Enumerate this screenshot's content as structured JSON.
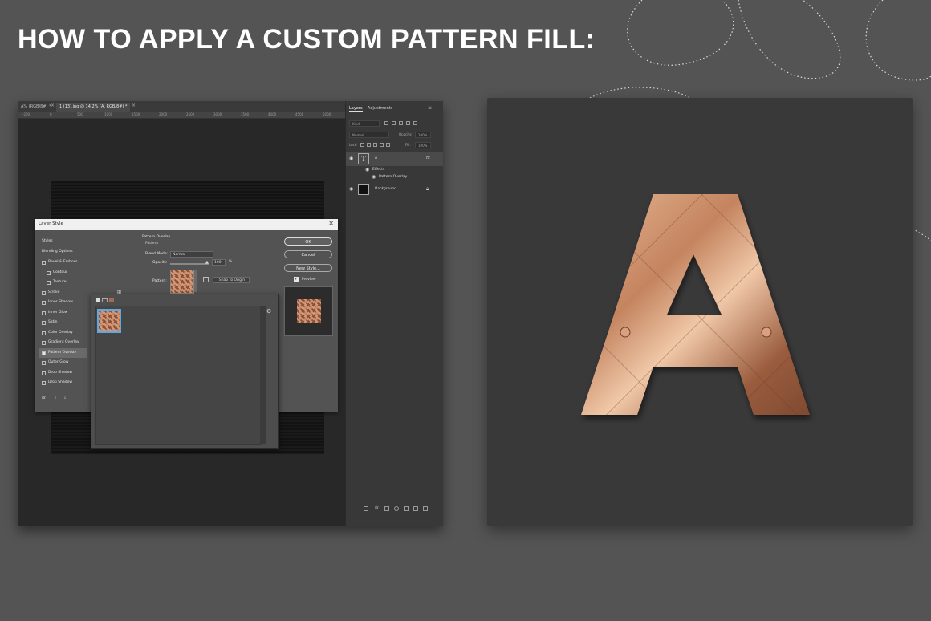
{
  "headline": "HOW TO APPLY A CUSTOM PATTERN FILL:",
  "colors": {
    "page_bg": "#545454",
    "result_bg": "#393939",
    "copper_light": "#e8b896",
    "copper_mid": "#c4845f",
    "copper_dark": "#7e4a31"
  },
  "photoshop": {
    "tabs": [
      {
        "label": "A% (RGB/8#) *",
        "active": false
      },
      {
        "label": "1 (13).jpg @ 14,2% (A, RGB/8#) *",
        "active": true
      }
    ],
    "ruler_ticks": [
      "-200",
      "0",
      "500",
      "1000",
      "1500",
      "2000",
      "2500",
      "3000",
      "3500",
      "4000",
      "4500",
      "5000"
    ],
    "layers_panel": {
      "tabs": [
        "Layers",
        "Adjustments"
      ],
      "kind_filter": "Kind",
      "blend_mode": "Normal",
      "opacity_label": "Opacity:",
      "opacity_value": "100%",
      "lock_label": "Lock:",
      "fill_label": "Fill:",
      "fill_value": "100%",
      "layers": [
        {
          "name": "A",
          "thumb": "T",
          "selected": true,
          "fx": "fx"
        },
        {
          "name": "Effects",
          "sub": true
        },
        {
          "name": "Pattern Overlay",
          "sub2": true
        },
        {
          "name": "Background",
          "thumb": "",
          "locked": true
        }
      ]
    },
    "layer_style": {
      "title": "Layer Style",
      "close": "✕",
      "styles_header": "Styles",
      "blending_options": "Blending Options",
      "items": [
        {
          "label": "Bevel & Emboss",
          "checked": false,
          "plus": false
        },
        {
          "label": "Contour",
          "checked": false,
          "plus": false,
          "indent": true
        },
        {
          "label": "Texture",
          "checked": false,
          "plus": false,
          "indent": true
        },
        {
          "label": "Stroke",
          "checked": false,
          "plus": true
        },
        {
          "label": "Inner Shadow",
          "checked": false,
          "plus": true
        },
        {
          "label": "Inner Glow",
          "checked": false,
          "plus": false
        },
        {
          "label": "Satin",
          "checked": false,
          "plus": false
        },
        {
          "label": "Color Overlay",
          "checked": false,
          "plus": true
        },
        {
          "label": "Gradient Overlay",
          "checked": false,
          "plus": true
        },
        {
          "label": "Pattern Overlay",
          "checked": true,
          "plus": false,
          "selected": true
        },
        {
          "label": "Outer Glow",
          "checked": false,
          "plus": false
        },
        {
          "label": "Drop Shadow",
          "checked": false,
          "plus": true
        },
        {
          "label": "Drop Shadow",
          "checked": false,
          "plus": true
        }
      ],
      "section_title": "Pattern Overlay",
      "section_sub": "Pattern",
      "blend_mode_label": "Blend Mode:",
      "blend_mode_value": "Normal",
      "opacity_label": "Opacity:",
      "opacity_value": "100",
      "opacity_unit": "%",
      "pattern_label": "Pattern:",
      "snap_button": "Snap to Origin",
      "buttons": {
        "ok": "OK",
        "cancel": "Cancel",
        "new_style": "New Style...",
        "preview": "Preview"
      },
      "preview_checked": true,
      "footer": [
        "fx",
        "⇧",
        "⇩"
      ]
    },
    "pattern_picker": {
      "settings_icon": "gear-icon",
      "pattern_count": 1
    }
  },
  "result": {
    "letter": "A"
  }
}
